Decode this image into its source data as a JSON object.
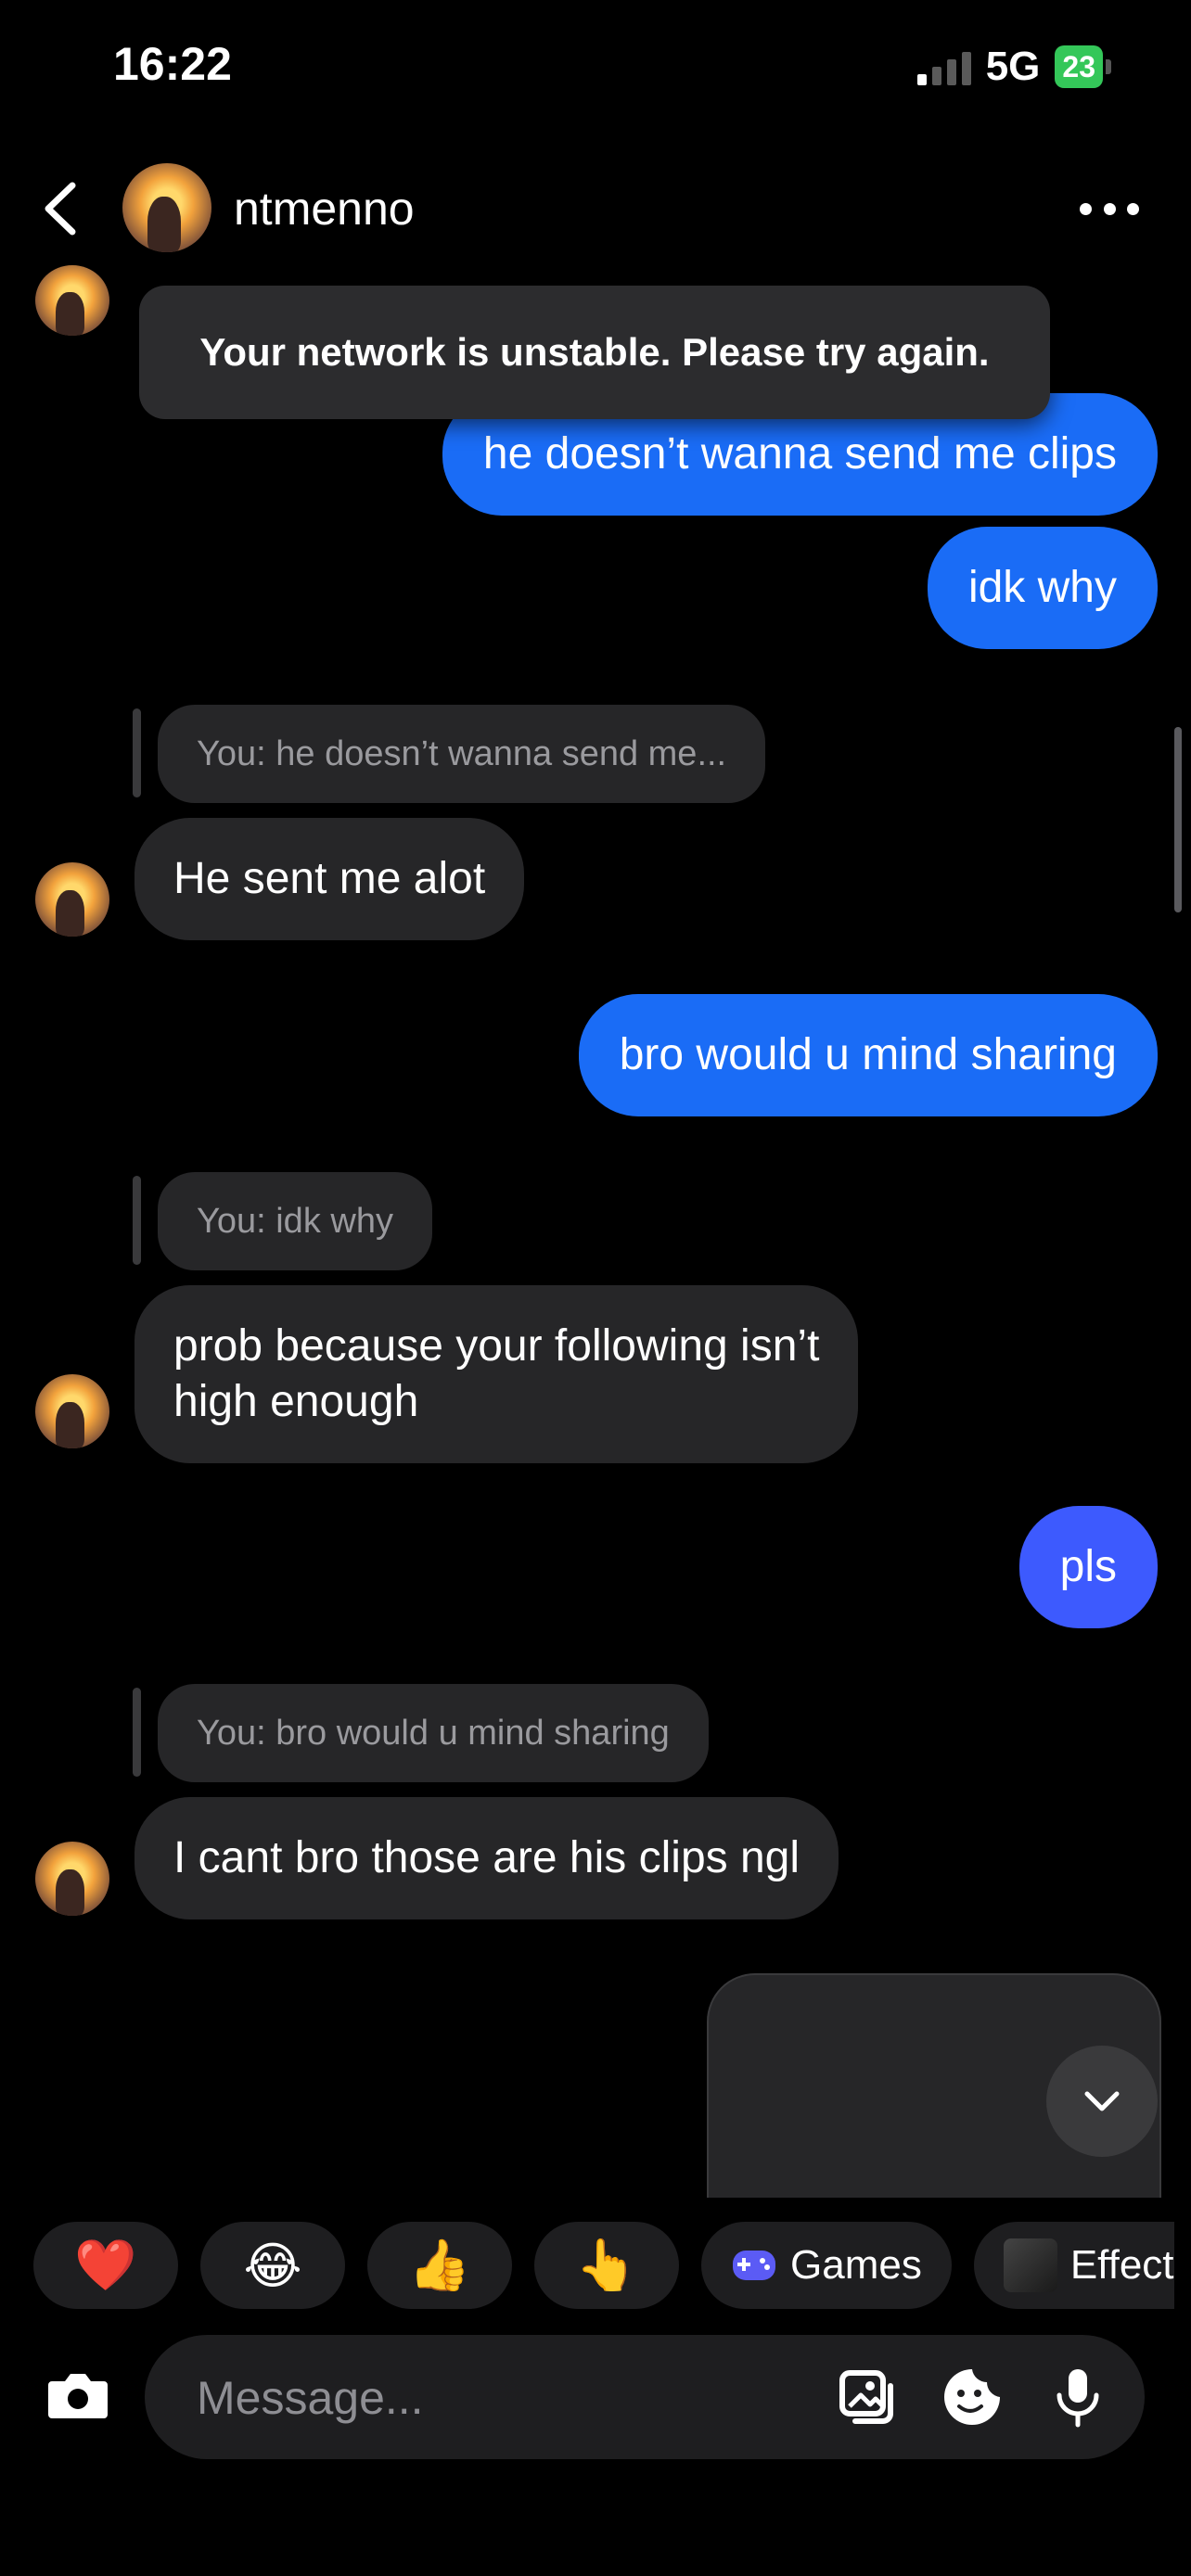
{
  "status_bar": {
    "time": "16:22",
    "network": "5G",
    "battery": "23"
  },
  "header": {
    "name": "ntmenno"
  },
  "toast": "Your network is unstable. Please try again.",
  "messages": {
    "out1": "he doesn’t wanna send me clips",
    "out2": "idk why",
    "reply1": "You: he doesn’t wanna send me...",
    "in1": "He sent me alot",
    "out3": "bro would u mind sharing",
    "reply2": "You: idk why",
    "in2_line1": "prob because your following isn’t",
    "in2_line2": "high enough",
    "out4": "pls",
    "reply3": "You: bro would u mind sharing",
    "in3": "I cant bro those are his clips ngl"
  },
  "quick_actions": {
    "emoji1": "❤️",
    "emoji2": "😂",
    "emoji3": "👍",
    "emoji4": "👆",
    "games_label": "Games",
    "effects_label": "Effect"
  },
  "composer": {
    "placeholder": "Message..."
  },
  "colors": {
    "outgoing_bubble": "#1a6cf6",
    "outgoing_bubble_alt": "#3d5afe",
    "incoming_bubble": "#262628",
    "battery": "#34c759"
  }
}
